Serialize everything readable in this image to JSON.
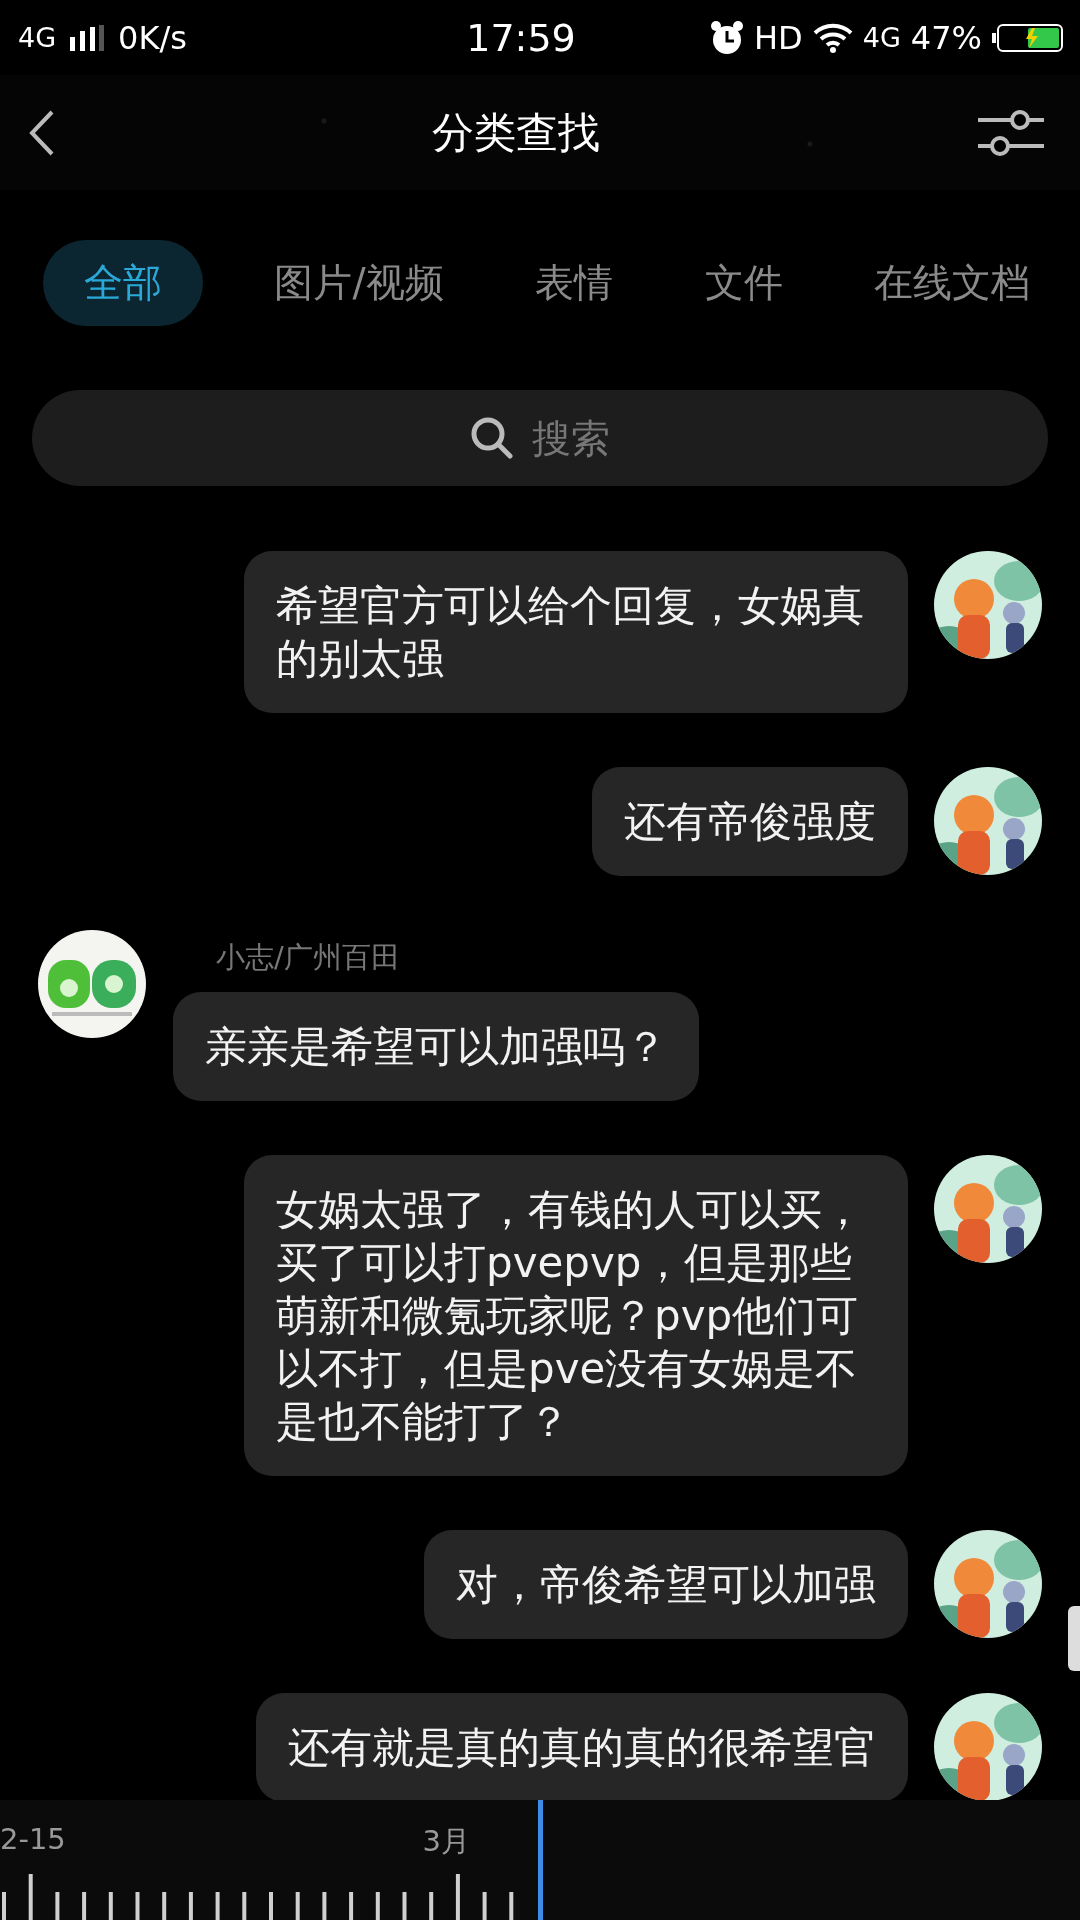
{
  "status_bar": {
    "network": "4G",
    "speed": "0K/s",
    "time": "17:59",
    "hd": "HD",
    "data_network": "4G",
    "battery": "47%"
  },
  "header": {
    "title": "分类查找"
  },
  "tabs": [
    {
      "label": "全部",
      "selected": true
    },
    {
      "label": "图片/视频",
      "selected": false
    },
    {
      "label": "表情",
      "selected": false
    },
    {
      "label": "文件",
      "selected": false
    },
    {
      "label": "在线文档",
      "selected": false
    }
  ],
  "search": {
    "placeholder": "搜索"
  },
  "messages": [
    {
      "kind": "outgoing",
      "text": "希望官方可以给个回复，女娲真的别太强"
    },
    {
      "kind": "outgoing",
      "text": "还有帝俊强度"
    },
    {
      "kind": "incoming",
      "sender": "小志/广州百田",
      "text": "亲亲是希望可以加强吗？"
    },
    {
      "kind": "outgoing",
      "text": "女娲太强了，有钱的人可以买，买了可以打pvepvp，但是那些萌新和微氪玩家呢？pvp他们可以不打，但是pve没有女娲是不是也不能打了？"
    },
    {
      "kind": "outgoing",
      "text": "对，帝俊希望可以加强"
    },
    {
      "kind": "outgoing",
      "text": "还有就是真的真的真的很希望官"
    }
  ],
  "timeline": {
    "labels": [
      "2-15",
      "3月"
    ]
  }
}
